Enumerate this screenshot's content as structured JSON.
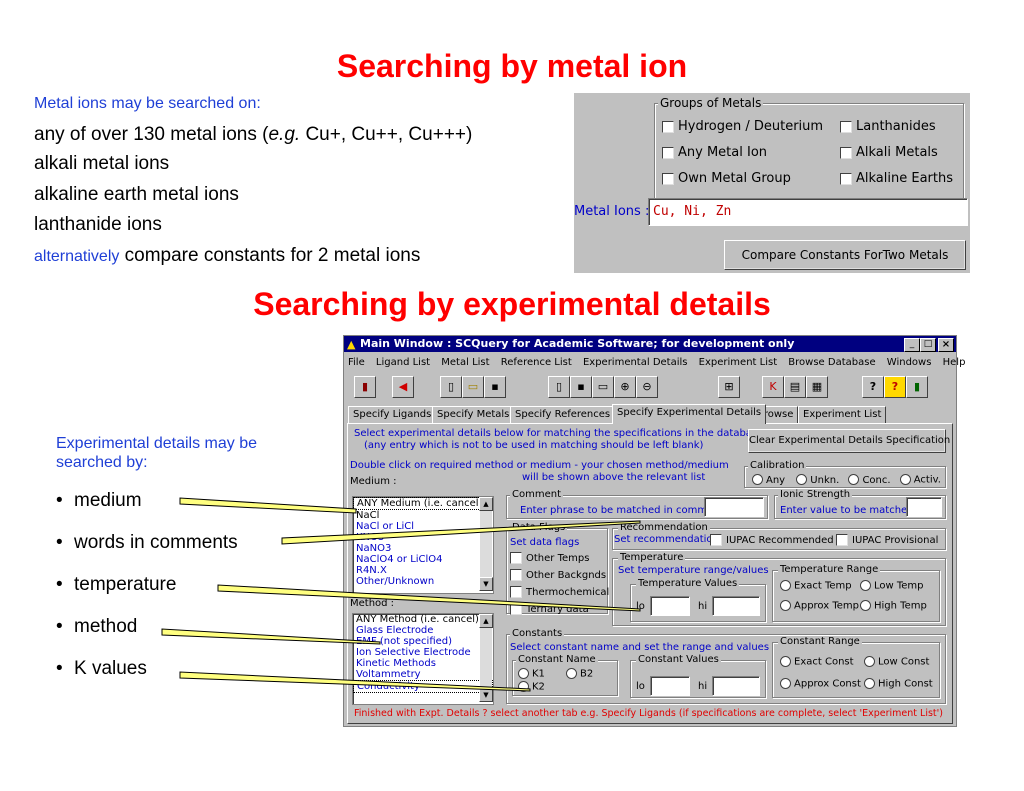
{
  "heading1": "Searching by metal ion",
  "metal_intro": "Metal ions may be searched on:",
  "metal_line1_a": "any of over 130 metal ions (",
  "metal_line1_eg": "e.g.",
  "metal_line1_b": " Cu+, Cu++, Cu+++)",
  "metal_line2": "alkali metal ions",
  "metal_line3": "alkaline earth metal ions",
  "metal_line4": "lanthanide ions",
  "metal_line5_blue": "alternatively",
  "metal_line5_rest": " compare constants for 2 metal ions",
  "heading2": "Searching by experimental details",
  "exp_intro": "Experimental details may be searched by:",
  "bullets": [
    "medium",
    "words in comments",
    "temperature",
    "method",
    "K values"
  ],
  "metal_panel": {
    "group_title": "Groups of Metals",
    "checks": [
      "Hydrogen / Deuterium",
      "Lanthanides",
      "Any Metal Ion",
      "Alkali Metals",
      "Own Metal Group",
      "Alkaline Earths"
    ],
    "label": "Metal Ions :",
    "value": "Cu, Ni, Zn",
    "compare_button": "Compare Constants ForTwo Metals"
  },
  "window": {
    "title": "Main Window  :  SCQuery for Academic Software; for development only",
    "menu": [
      "File",
      "Ligand List",
      "Metal List",
      "Reference List",
      "Experimental Details",
      "Experiment List",
      "Browse Database",
      "Windows",
      "Help"
    ],
    "tabs": [
      "Specify Ligands",
      "Specify Metals",
      "Specify References",
      "Specify Experimental Details",
      "Browse",
      "Experiment List"
    ],
    "instr1": "Select experimental details below for matching the specifications in the database",
    "instr2": "(any entry which is not to be used in matching should be left blank)",
    "clear_button": "Clear Experimental Details Specification",
    "dbl1": "Double click on required method or medium - your chosen method/medium",
    "dbl2": "will be shown above the relevant list",
    "medium_label": "Medium :",
    "calibration": "Calibration",
    "calib_opts": [
      "Any",
      "Unkn.",
      "Conc.",
      "Activ."
    ],
    "medium_list": [
      "ANY Medium (i.e. cancel)",
      "NaCl",
      "NaCl or LiCl",
      "KNO3",
      "NaNO3",
      "NaClO4 or LiClO4",
      "R4N.X",
      "Other/Unknown"
    ],
    "comment_group": "Comment",
    "comment_text": "Enter phrase to be matched in comment",
    "ionic_group": "Ionic Strength",
    "ionic_text": "Enter value to be matched",
    "dataflags_group": "Data Flags",
    "dataflags_text": "Set data flags",
    "flag_checks": [
      "Other Temps",
      "Other Backgnds",
      "Thermochemical",
      "Ternary data"
    ],
    "recommend_group": "Recommendation",
    "recommend_text": "Set recommendation",
    "iupac_rec": "IUPAC Recommended",
    "iupac_prov": "IUPAC Provisional",
    "temp_group": "Temperature",
    "temp_text": "Set temperature range/values",
    "temp_values": "Temperature Values",
    "lo": "lo",
    "hi": "hi",
    "temp_range": "Temperature Range",
    "temp_opts": [
      "Exact Temp",
      "Low Temp",
      "Approx Temp",
      "High Temp"
    ],
    "method_label": "Method :",
    "method_list": [
      "ANY Method (i.e. cancel)",
      "Glass Electrode",
      "EMF (not specified)",
      "Ion Selective Electrode",
      "Kinetic Methods",
      "Voltammetry",
      "Conductivity"
    ],
    "const_group": "Constants",
    "const_text": "Select constant name and set the range and values",
    "const_name": "Constant Name",
    "const_opts": [
      "K1",
      "B2",
      "K2"
    ],
    "const_values": "Constant Values",
    "const_range": "Constant Range",
    "const_range_opts": [
      "Exact Const",
      "Low Const",
      "Approx Const",
      "High Const"
    ],
    "status": "Finished with Expt. Details ? select another tab e.g. Specify Ligands  (if specifications are complete, select 'Experiment List')"
  }
}
